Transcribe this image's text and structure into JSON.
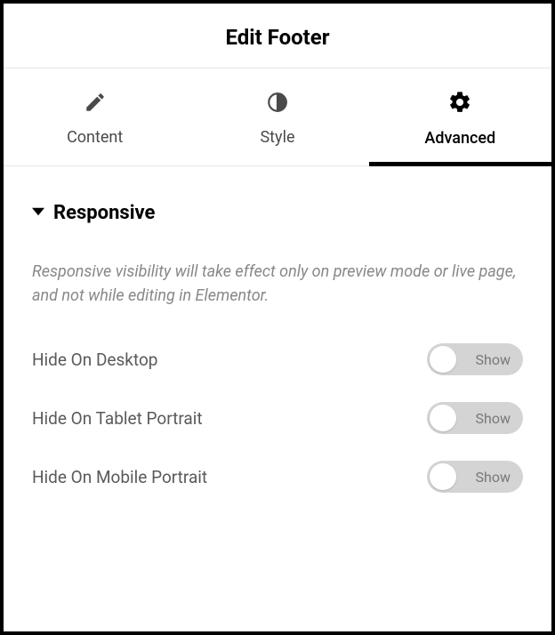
{
  "header": {
    "title": "Edit Footer"
  },
  "tabs": {
    "content": {
      "label": "Content",
      "icon": "pencil-icon"
    },
    "style": {
      "label": "Style",
      "icon": "contrast-icon"
    },
    "advanced": {
      "label": "Advanced",
      "icon": "gear-icon",
      "active": true
    }
  },
  "section": {
    "title": "Responsive",
    "description": "Responsive visibility will take effect only on preview mode or live page, and not while editing in Elementor."
  },
  "controls": {
    "hide_desktop": {
      "label": "Hide On Desktop",
      "state_label": "Show"
    },
    "hide_tablet": {
      "label": "Hide On Tablet Portrait",
      "state_label": "Show"
    },
    "hide_mobile": {
      "label": "Hide On Mobile Portrait",
      "state_label": "Show"
    }
  }
}
